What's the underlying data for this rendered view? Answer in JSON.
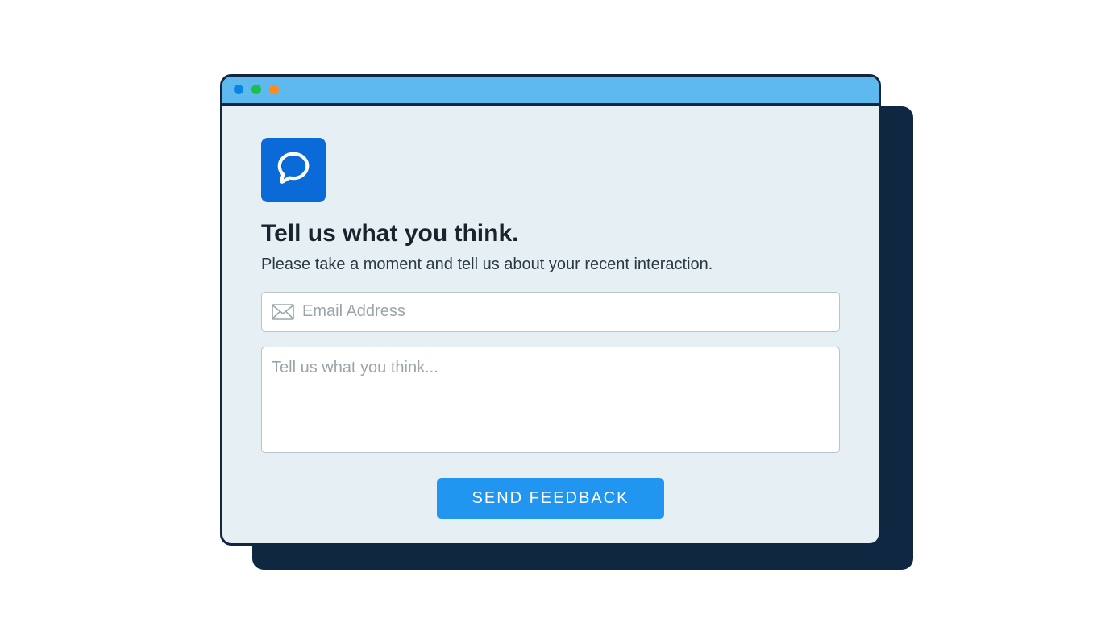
{
  "window": {
    "traffic_lights": [
      "blue",
      "green",
      "orange"
    ]
  },
  "form": {
    "heading": "Tell us what you think.",
    "subheading": "Please take a moment and tell us about your recent interaction.",
    "email_placeholder": "Email Address",
    "email_value": "",
    "message_placeholder": "Tell us what you think...",
    "message_value": "",
    "submit_label": "SEND FEEDBACK"
  },
  "colors": {
    "accent": "#0a6bd8",
    "button": "#2196f0",
    "titlebar": "#5eb9ef",
    "shadow": "#0f2740",
    "panel": "#e6eff4"
  },
  "icons": {
    "app": "speech-bubble-icon",
    "email": "envelope-icon"
  }
}
